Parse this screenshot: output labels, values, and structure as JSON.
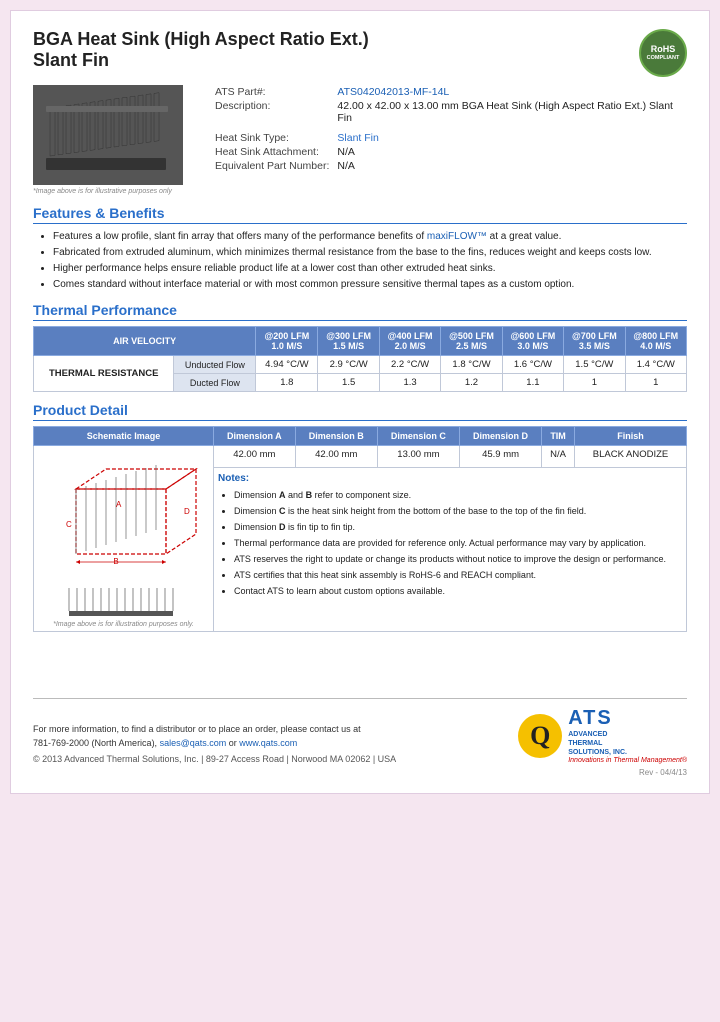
{
  "header": {
    "title_line1": "BGA Heat Sink (High Aspect Ratio Ext.)",
    "title_line2": "Slant Fin",
    "rohs": "RoHS\nCOMPLIANT"
  },
  "specs": {
    "part_label": "ATS Part#:",
    "part_value": "ATS042042013-MF-14L",
    "desc_label": "Description:",
    "desc_value": "42.00 x 42.00 x 13.00 mm BGA Heat Sink (High Aspect Ratio Ext.) Slant Fin",
    "type_label": "Heat Sink Type:",
    "type_value": "Slant Fin",
    "attachment_label": "Heat Sink Attachment:",
    "attachment_value": "N/A",
    "equiv_label": "Equivalent Part Number:",
    "equiv_value": "N/A"
  },
  "image_caption": "*Image above is for illustrative purposes only",
  "features": {
    "section_title": "Features & Benefits",
    "items": [
      "Features a low profile, slant fin array that offers many of the performance benefits of maxiFLOW™ at a great value.",
      "Fabricated from extruded aluminum, which minimizes thermal resistance from the base to the fins, reduces weight and keeps costs low.",
      "Higher performance helps ensure reliable product life at a lower cost than other extruded heat sinks.",
      "Comes standard without interface material or with most common pressure sensitive thermal tapes as a custom option."
    ]
  },
  "thermal": {
    "section_title": "Thermal Performance",
    "col_header_label": "AIR VELOCITY",
    "columns": [
      {
        "lfm": "@200 LFM",
        "ms": "1.0 M/S"
      },
      {
        "lfm": "@300 LFM",
        "ms": "1.5 M/S"
      },
      {
        "lfm": "@400 LFM",
        "ms": "2.0 M/S"
      },
      {
        "lfm": "@500 LFM",
        "ms": "2.5 M/S"
      },
      {
        "lfm": "@600 LFM",
        "ms": "3.0 M/S"
      },
      {
        "lfm": "@700 LFM",
        "ms": "3.5 M/S"
      },
      {
        "lfm": "@800 LFM",
        "ms": "4.0 M/S"
      }
    ],
    "row_group_label": "THERMAL RESISTANCE",
    "rows": [
      {
        "label": "Unducted Flow",
        "values": [
          "4.94 °C/W",
          "2.9 °C/W",
          "2.2 °C/W",
          "1.8 °C/W",
          "1.6 °C/W",
          "1.5 °C/W",
          "1.4 °C/W"
        ]
      },
      {
        "label": "Ducted Flow",
        "values": [
          "1.8",
          "1.5",
          "1.3",
          "1.2",
          "1.1",
          "1",
          "1"
        ]
      }
    ]
  },
  "product_detail": {
    "section_title": "Product Detail",
    "columns": [
      "Schematic Image",
      "Dimension A",
      "Dimension B",
      "Dimension C",
      "Dimension D",
      "TIM",
      "Finish"
    ],
    "values": {
      "dim_a": "42.00 mm",
      "dim_b": "42.00 mm",
      "dim_c": "13.00 mm",
      "dim_d": "45.9 mm",
      "tim": "N/A",
      "finish": "BLACK ANODIZE"
    },
    "notes_title": "Notes:",
    "notes": [
      "Dimension A and B refer to component size.",
      "Dimension C is the heat sink height from the bottom of the base to the top of the fin field.",
      "Dimension D is fin tip to fin tip.",
      "Thermal performance data are provided for reference only. Actual performance may vary by application.",
      "ATS reserves the right to update or change its products without notice to improve the design or performance.",
      "ATS certifies that this heat sink assembly is RoHS-6 and REACH compliant.",
      "Contact ATS to learn about custom options available."
    ],
    "schematic_caption": "*Image above is for illustration purposes only."
  },
  "footer": {
    "contact_text": "For more information, to find a distributor or to place an order, please contact us at",
    "phone": "781-769-2000 (North America),",
    "email": "sales@qats.com",
    "or": "or",
    "website": "www.qats.com",
    "copyright": "© 2013 Advanced Thermal Solutions, Inc. | 89-27 Access Road | Norwood MA  02062 | USA",
    "page_num": "Rev - 04/4/13",
    "ats_letter": "Q",
    "ats_name": "ATS",
    "ats_full": "ADVANCED\nTHERMAL\nSOLUTIONS, INC.",
    "ats_tagline": "Innovations in Thermal Management®"
  }
}
